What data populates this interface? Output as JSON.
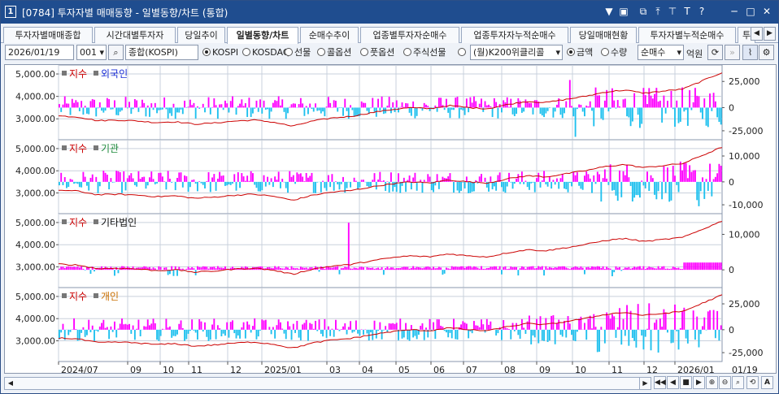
{
  "window": {
    "number": "1",
    "title": "[0784] 투자자별 매매동향 - 일별동향/차트 (통합)",
    "buttons": [
      "▼",
      "▣",
      "⧉",
      "⤒",
      "⊤",
      "T",
      "?",
      "─",
      "□",
      "✕"
    ]
  },
  "tabs": [
    "투자자별매매종합",
    "시간대별투자자",
    "당일추이",
    "일별동향/차트",
    "순매수추이",
    "업종별투자자순매수",
    "업종투자자누적순매수",
    "당일매매현황",
    "투자자별누적순매수",
    "투"
  ],
  "active_tab": 3,
  "toolbar": {
    "date": "2026/01/19",
    "code": "001",
    "market_name": "종합(KOSPI)",
    "market_radios": [
      {
        "label": "KOSPI",
        "checked": true
      },
      {
        "label": "KOSDAQ",
        "checked": false
      },
      {
        "label": "선물",
        "checked": false
      },
      {
        "label": "콜옵션",
        "checked": false
      },
      {
        "label": "풋옵션",
        "checked": false
      },
      {
        "label": "주식선물",
        "checked": false
      },
      {
        "label": "",
        "checked": false
      }
    ],
    "underlying_select": "(월)K200위클리콜",
    "unit_radios": [
      {
        "label": "금액",
        "checked": true
      },
      {
        "label": "수량",
        "checked": false
      }
    ],
    "type_select": "순매수",
    "unit_label": "억원"
  },
  "panels": [
    {
      "index_label": "지수",
      "investor": "외국인",
      "investor_color": "#1b2fd6",
      "right_ticks": [
        "25,000",
        "0",
        "-25,000"
      ]
    },
    {
      "index_label": "지수",
      "investor": "기관",
      "investor_color": "#1d8a3b",
      "right_ticks": [
        "10,000",
        "0",
        "-10,000"
      ]
    },
    {
      "index_label": "지수",
      "investor": "기타법인",
      "investor_color": "#111111",
      "right_ticks": [
        "10,000",
        "0"
      ]
    },
    {
      "index_label": "지수",
      "investor": "개인",
      "investor_color": "#c96f00",
      "right_ticks": [
        "25,000",
        "0",
        "-25,000"
      ]
    }
  ],
  "left_ticks": [
    "5,000.00",
    "4,000.00",
    "3,000.00"
  ],
  "x_labels": [
    "2024/07",
    "09",
    "10",
    "11",
    "12",
    "2025/01",
    "03",
    "04",
    "05",
    "06",
    "07",
    "08",
    "09",
    "10",
    "11",
    "12",
    "2026/01"
  ],
  "x_last_label": "01/19",
  "colors": {
    "positive": "#ff00ff",
    "negative": "#1ec0ee",
    "index_line": "#cc0000",
    "index_label": "#cc0000",
    "grid": "#c9d0dc"
  },
  "chart_data": {
    "type": "bar",
    "description_units": "net buying (억원) per trading day with KOSPI index line",
    "index_approx": [
      2800,
      2750,
      2570,
      2600,
      2560,
      2480,
      2520,
      2400,
      2460,
      2550,
      2600,
      2500,
      2300,
      2550,
      2700,
      2780,
      2950,
      3100,
      3200,
      3150,
      3300,
      3200,
      3150,
      3350,
      3500,
      3450,
      3600,
      3750,
      3950,
      4050,
      3900,
      4000,
      4100,
      4500,
      4900
    ],
    "panels": [
      {
        "name": "외국인",
        "ylim": [
          -30000,
          30000
        ]
      },
      {
        "name": "기관",
        "ylim": [
          -15000,
          15000
        ]
      },
      {
        "name": "기타법인",
        "ylim": [
          -5000,
          15000
        ]
      },
      {
        "name": "개인",
        "ylim": [
          -30000,
          30000
        ]
      }
    ]
  }
}
